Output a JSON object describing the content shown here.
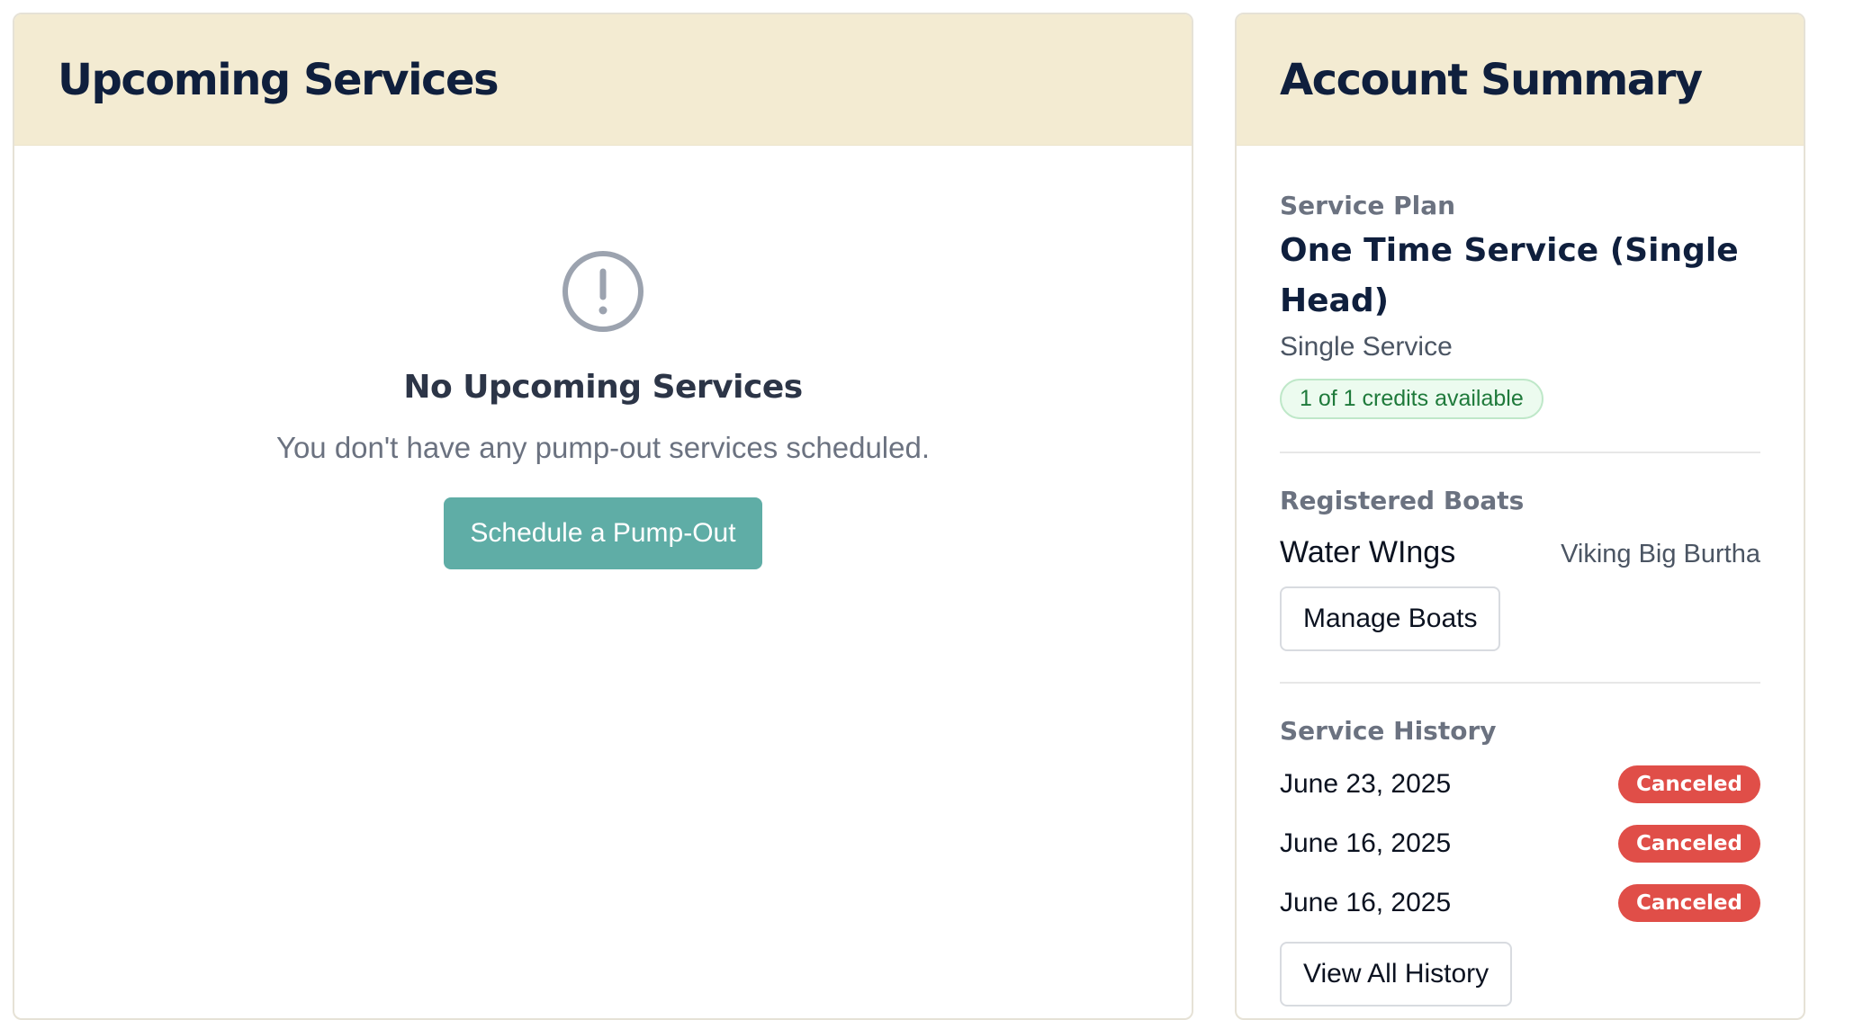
{
  "upcoming": {
    "title": "Upcoming Services",
    "empty_icon": "alert-circle-icon",
    "empty_title": "No Upcoming Services",
    "empty_text": "You don't have any pump-out services scheduled.",
    "schedule_button": "Schedule a Pump-Out"
  },
  "account": {
    "title": "Account Summary",
    "plan": {
      "label": "Service Plan",
      "name": "One Time Service (Single Head)",
      "type": "Single Service",
      "credits": "1 of 1 credits available"
    },
    "boats": {
      "label": "Registered Boats",
      "items": [
        {
          "name": "Water WIngs",
          "model": "Viking Big Burtha"
        }
      ],
      "manage_button": "Manage Boats"
    },
    "history": {
      "label": "Service History",
      "items": [
        {
          "date": "June 23, 2025",
          "status": "Canceled"
        },
        {
          "date": "June 16, 2025",
          "status": "Canceled"
        },
        {
          "date": "June 16, 2025",
          "status": "Canceled"
        }
      ],
      "view_all_button": "View All History"
    }
  },
  "colors": {
    "header_bg": "#f3ebd2",
    "accent": "#5fada6",
    "canceled": "#e04e48",
    "credits_green": "#1f7a3b"
  }
}
